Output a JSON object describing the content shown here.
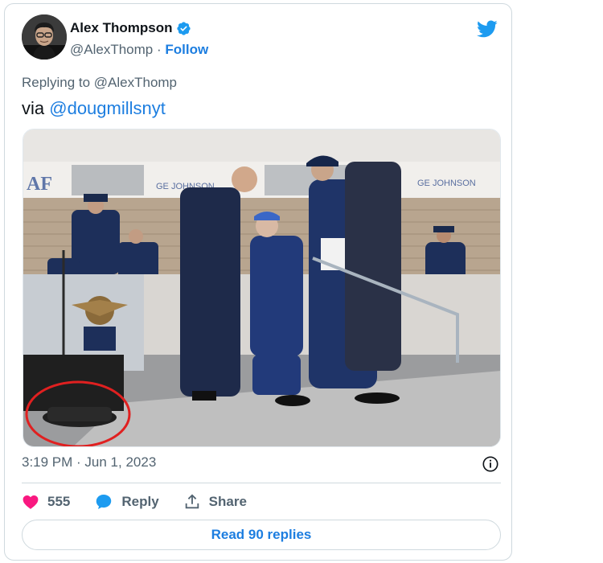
{
  "author": {
    "name": "Alex Thompson",
    "handle": "@AlexThomp",
    "separator": "·",
    "follow_label": "Follow",
    "verified": true
  },
  "reply_context": "Replying to @AlexThomp",
  "tweet": {
    "prefix": "via",
    "mention": "@dougmillsnyt"
  },
  "photo_signs": [
    "AF",
    "GE JOHNSON",
    "GE JOHNSON"
  ],
  "timestamp": "3:19 PM · Jun 1, 2023",
  "actions": {
    "like_count": "555",
    "reply_label": "Reply",
    "share_label": "Share"
  },
  "read_replies_label": "Read 90 replies",
  "colors": {
    "accent_blue": "#1d7ee0",
    "twitter_blue": "#1d9bf0",
    "like_pink": "#f91880",
    "muted": "#536471",
    "annotation_red": "#e02020"
  },
  "icons": [
    "verified-badge-icon",
    "twitter-bird-icon",
    "info-icon",
    "heart-icon",
    "reply-bubble-icon",
    "share-icon"
  ]
}
